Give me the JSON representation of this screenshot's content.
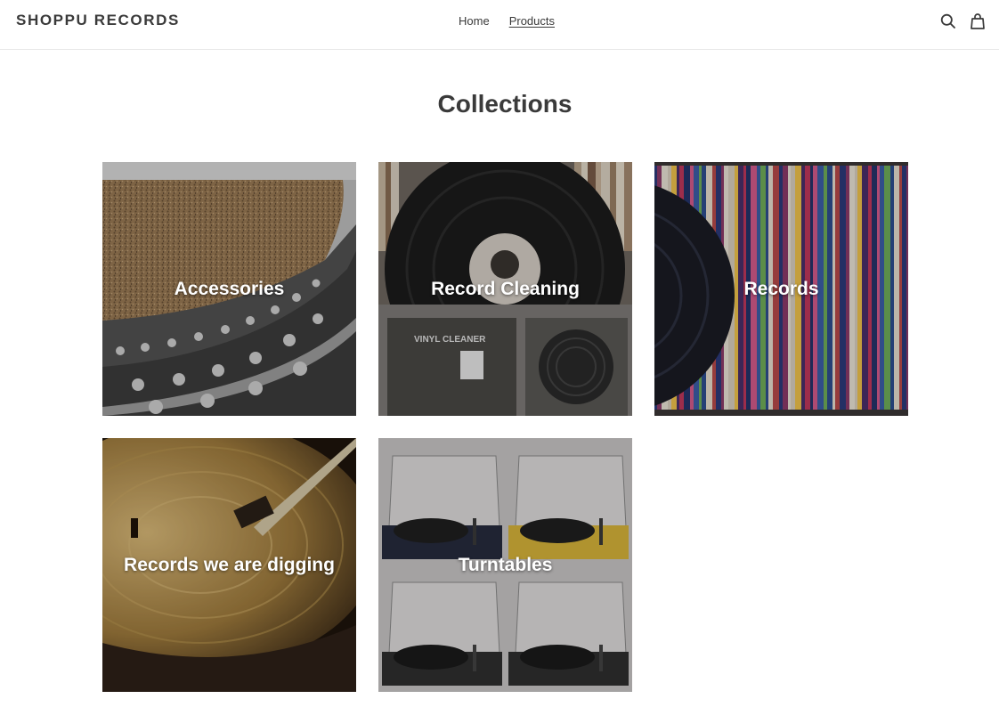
{
  "header": {
    "logo": "SHOPPU RECORDS",
    "nav": [
      {
        "label": "Home",
        "active": false
      },
      {
        "label": "Products",
        "active": true
      }
    ],
    "icons": [
      "search-icon",
      "cart-icon"
    ]
  },
  "main": {
    "title": "Collections",
    "collections": [
      {
        "label": "Accessories",
        "image": "cork-turntable-mat"
      },
      {
        "label": "Record Cleaning",
        "image": "vinyl-cleaner-machine"
      },
      {
        "label": "Records",
        "image": "record-shelf"
      },
      {
        "label": "Records we are digging",
        "image": "spinning-record"
      },
      {
        "label": "Turntables",
        "image": "turntables-grid"
      }
    ]
  },
  "colors": {
    "text": "#3a3a3a",
    "border": "#e8e8e8",
    "overlay_text": "#ffffff"
  }
}
